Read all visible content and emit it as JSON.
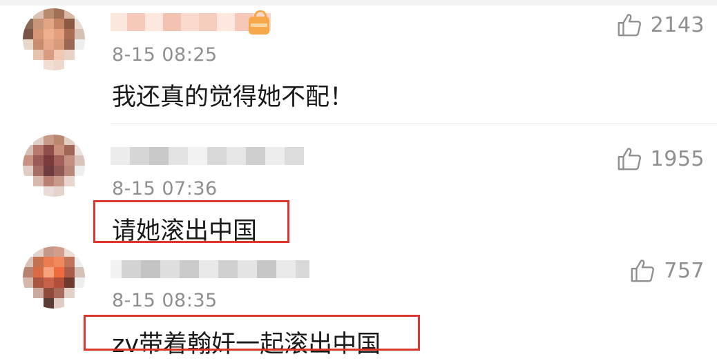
{
  "comments": [
    {
      "timestamp": "8-15 08:25",
      "text": "我还真的觉得她不配！",
      "likes": "2143",
      "has_vip_badge": true,
      "highlighted": false
    },
    {
      "timestamp": "8-15 07:36",
      "text": "请她滚出中国",
      "likes": "1955",
      "has_vip_badge": false,
      "highlighted": true
    },
    {
      "timestamp": "8-15 08:35",
      "text": "zv带着翰奸一起滚出中国",
      "likes": "757",
      "has_vip_badge": false,
      "highlighted": true
    }
  ],
  "icons": {
    "like": "thumbs-up-icon",
    "badge": "vip-badge-icon"
  },
  "colors": {
    "highlight": "#e0342e",
    "meta_text": "#8f8f8f",
    "body_text": "#1a1a1a",
    "vip": "#f6a84a"
  }
}
